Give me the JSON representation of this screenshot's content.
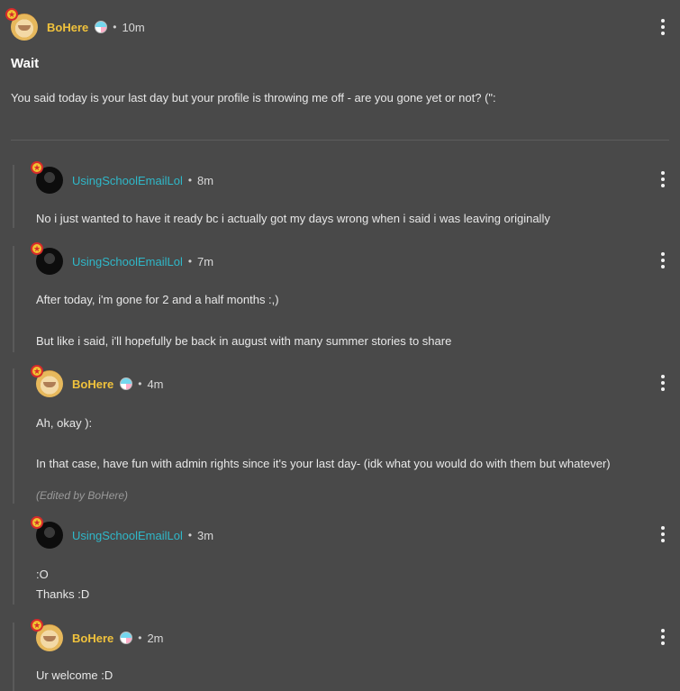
{
  "post": {
    "author": "BoHere",
    "time": "10m",
    "title": "Wait",
    "body": "You said today is your last day but your profile is throwing me off - are you gone yet or not? (\":"
  },
  "replies": [
    {
      "author": "UsingSchoolEmailLol",
      "time": "8m",
      "lines": [
        "No i just wanted to have it ready bc i actually got my days wrong when i said i was leaving originally"
      ]
    },
    {
      "author": "UsingSchoolEmailLol",
      "time": "7m",
      "lines": [
        "After today, i'm gone for 2 and a half months :,)",
        "But like i said, i'll hopefully be back in august with many summer stories to share"
      ]
    },
    {
      "author": "BoHere",
      "time": "4m",
      "lines": [
        "Ah, okay ):",
        "In that case, have fun with admin rights since it's your last day- (idk what you would do with them but whatever)"
      ],
      "edited": "(Edited by BoHere)"
    },
    {
      "author": "UsingSchoolEmailLol",
      "time": "3m",
      "lines": [
        ":O",
        "Thanks :D"
      ]
    },
    {
      "author": "BoHere",
      "time": "2m",
      "lines": [
        "Ur welcome :D"
      ]
    }
  ],
  "separator": "•",
  "colors": {
    "background": "#494949",
    "author_bohere": "#f0c23c",
    "author_usingschool": "#2fb8c9"
  },
  "icons": {
    "menu": "more-vertical-icon",
    "flag": "pride-flag-icon",
    "badge": "star-badge-icon"
  }
}
